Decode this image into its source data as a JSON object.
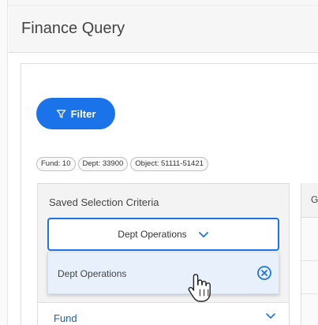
{
  "header": {
    "title": "Finance Query"
  },
  "toolbar": {
    "filter_label": "Filter"
  },
  "chips": [
    {
      "label": "Fund: 10"
    },
    {
      "label": "Dept: 33900"
    },
    {
      "label": "Object: 51111-51421"
    }
  ],
  "criteria": {
    "title": "Saved Selection Criteria",
    "selected_value": "Dept Operations",
    "options": [
      {
        "label": "Dept Operations"
      }
    ]
  },
  "fields": [
    {
      "label": "Fund"
    }
  ],
  "right_table": {
    "header_partial": "G"
  },
  "colors": {
    "accent": "#1a73e8",
    "link": "#1a5fb4",
    "option_bg": "#e8f0fb"
  },
  "icons": {
    "filter": "filter-funnel-icon",
    "chevron": "chevron-down-icon",
    "clear": "clear-circle-x-icon",
    "cursor": "hand-pointer-cursor-icon"
  }
}
